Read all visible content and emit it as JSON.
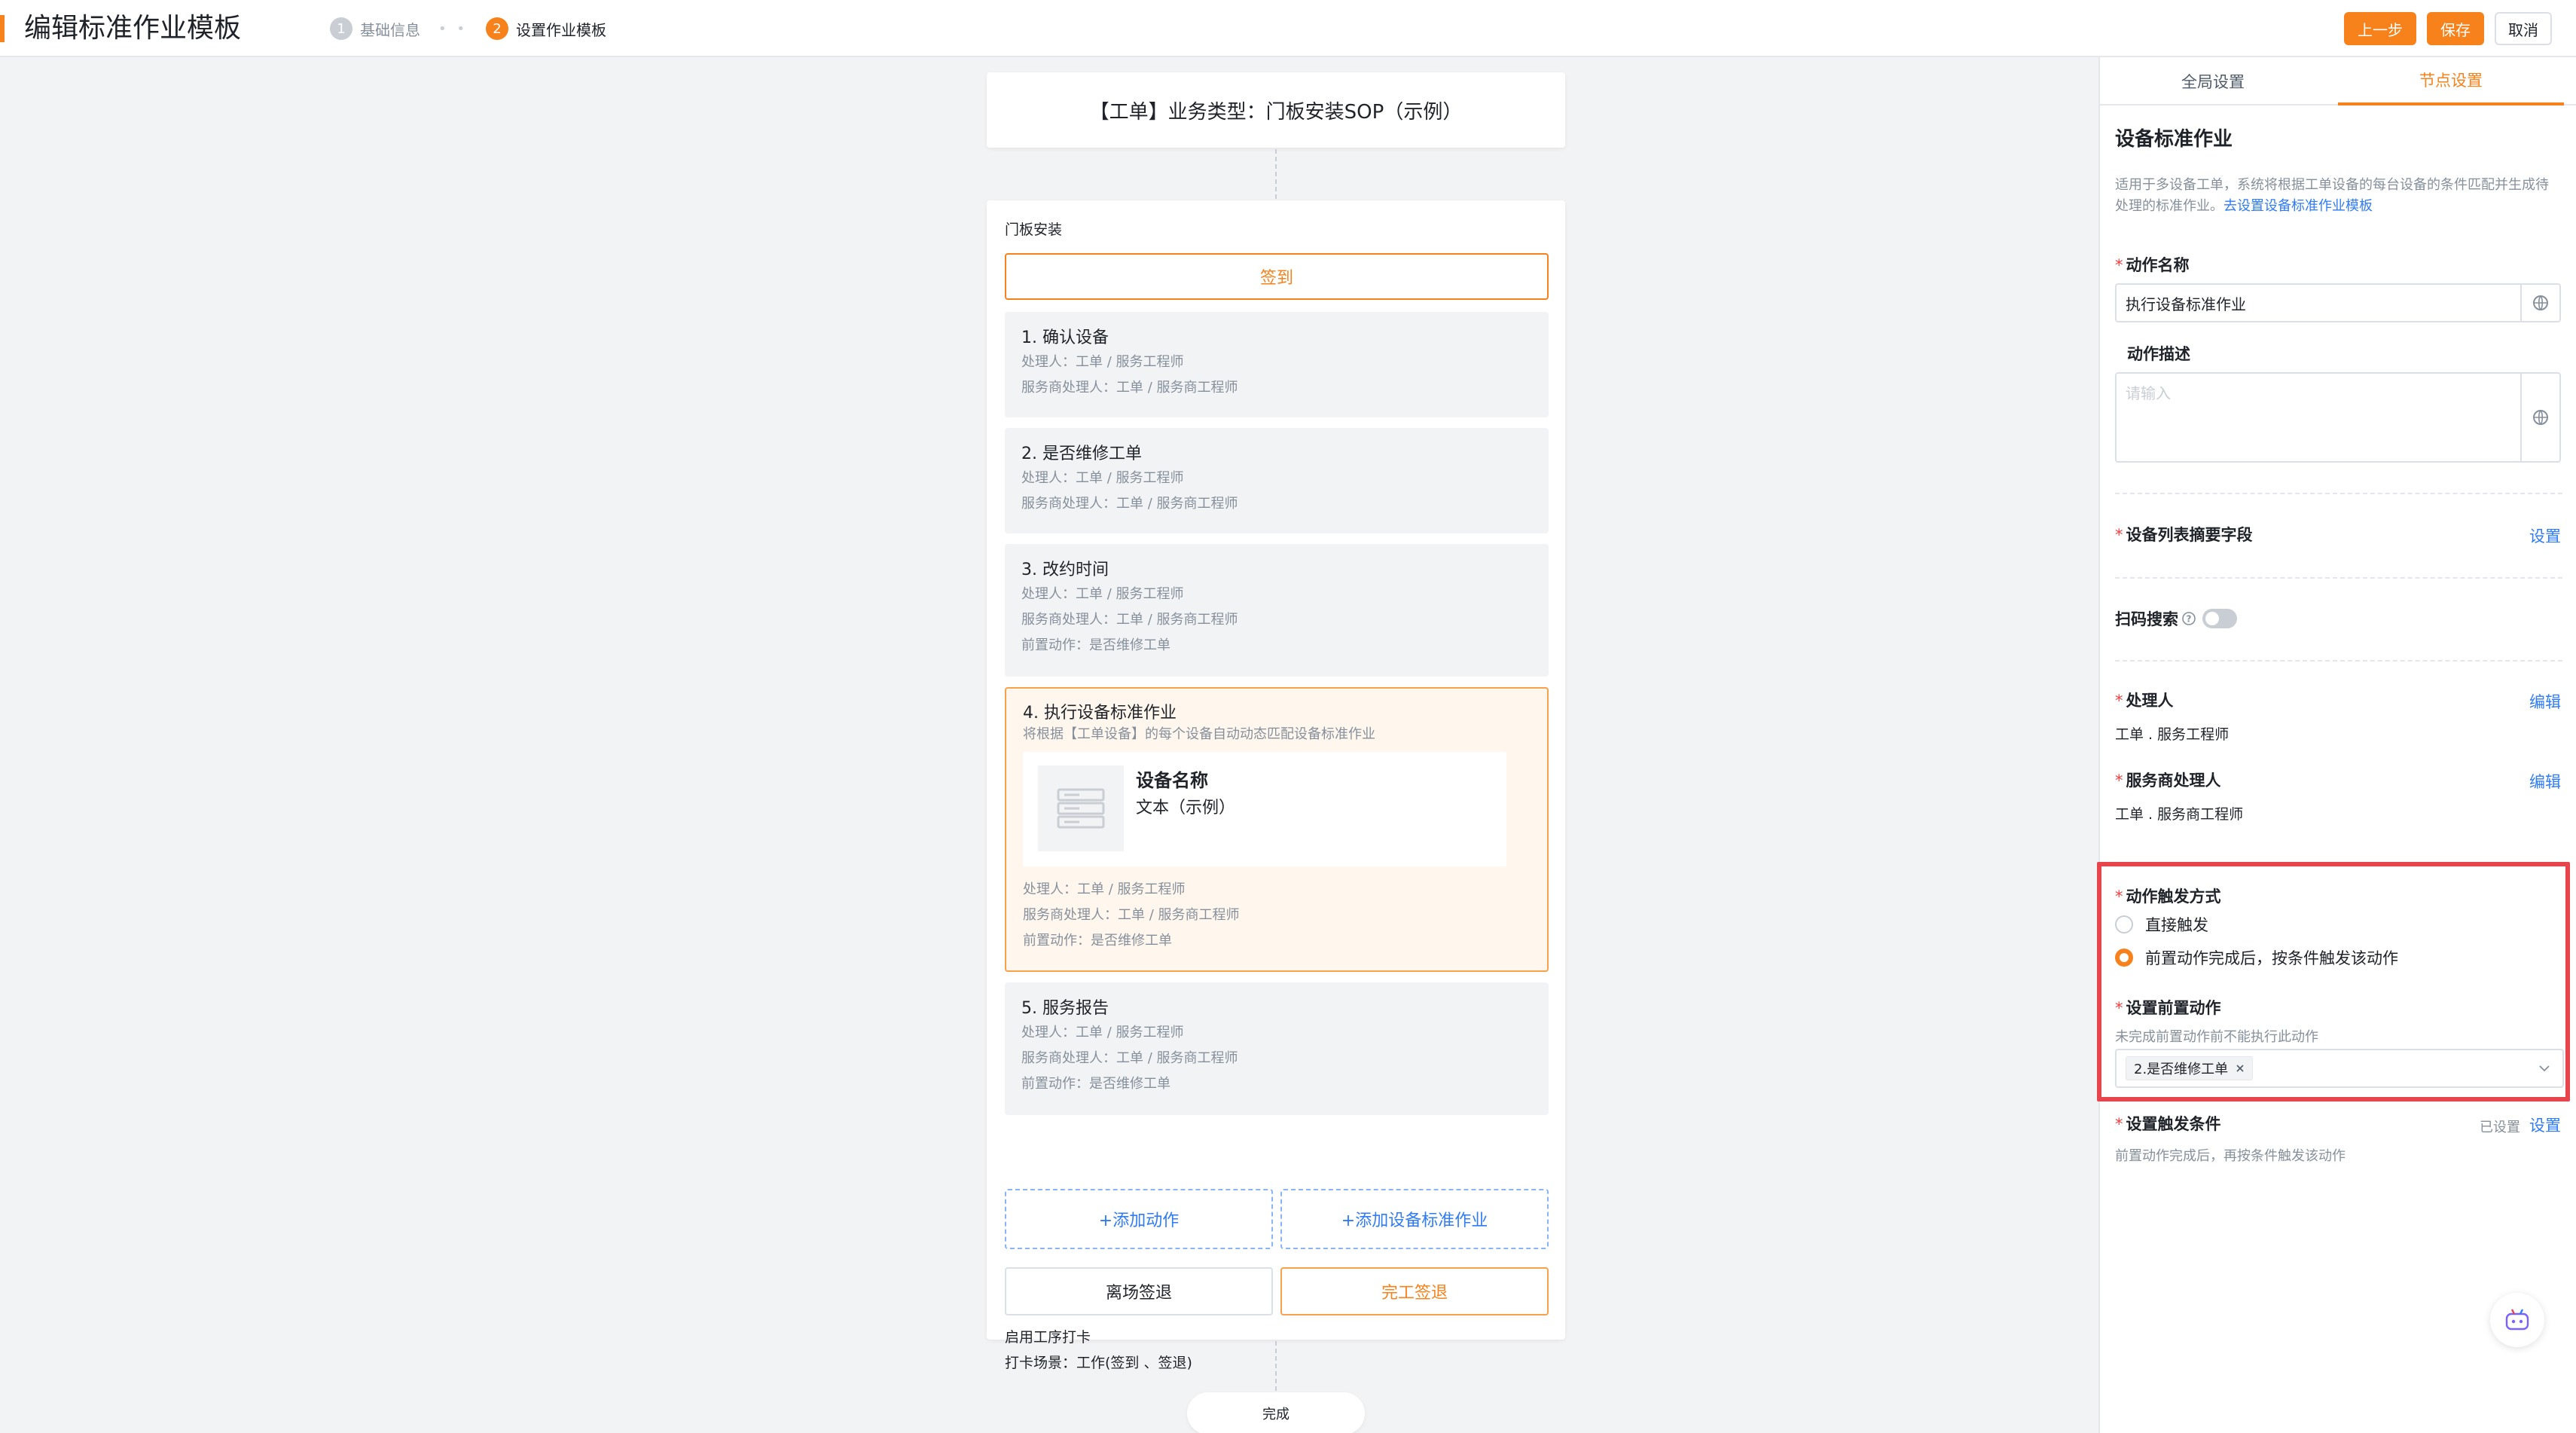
{
  "header": {
    "title": "编辑标准作业模板",
    "steps": [
      {
        "num": "1",
        "label": "基础信息",
        "state": "done"
      },
      {
        "num": "2",
        "label": "设置作业模板",
        "state": "active"
      }
    ],
    "step_separator": "• •",
    "buttons": {
      "prev": "上一步",
      "save": "保存",
      "cancel": "取消"
    }
  },
  "canvas": {
    "top_card_title": "【工单】业务类型：门板安装SOP（示例）",
    "section_title": "门板安装",
    "signin_label": "签到",
    "actions": [
      {
        "title": "1. 确认设备",
        "lines": [
          "处理人：工单 / 服务工程师",
          "服务商处理人：工单 / 服务商工程师"
        ]
      },
      {
        "title": "2. 是否维修工单",
        "lines": [
          "处理人：工单 / 服务工程师",
          "服务商处理人：工单 / 服务商工程师"
        ]
      },
      {
        "title": "3. 改约时间",
        "lines": [
          "处理人：工单 / 服务工程师",
          "服务商处理人：工单 / 服务商工程师",
          "前置动作：是否维修工单"
        ]
      },
      {
        "title": "4. 执行设备标准作业",
        "subtitle": "将根据【工单设备】的每个设备自动动态匹配设备标准作业",
        "device_name": "设备名称",
        "device_value": "文本（示例）",
        "lines": [
          "处理人：工单 / 服务工程师",
          "服务商处理人：工单 / 服务商工程师",
          "前置动作：是否维修工单"
        ]
      },
      {
        "title": "5. 服务报告",
        "lines": [
          "处理人：工单 / 服务工程师",
          "服务商处理人：工单 / 服务商工程师",
          "前置动作：是否维修工单"
        ]
      }
    ],
    "add_action": "+添加动作",
    "add_device_sop": "+添加设备标准作业",
    "leave_signout": "离场签退",
    "finish_signout": "完工签退",
    "clock_title": "启用工序打卡",
    "clock_scene": "打卡场景：工作(签到 、签退)",
    "end_node": "完成"
  },
  "panel": {
    "tabs": [
      "全局设置",
      "节点设置"
    ],
    "active_tab": 1,
    "heading": "设备标准作业",
    "description": "适用于多设备工单，系统将根据工单设备的每台设备的条件匹配并生成待处理的标准作业。",
    "description_link": "去设置设备标准作业模板",
    "action_name_label": "动作名称",
    "action_name_value": "执行设备标准作业",
    "action_desc_label": "动作描述",
    "action_desc_placeholder": "请输入",
    "summary_fields_label": "设备列表摘要字段",
    "summary_fields_link": "设置",
    "scan_search_label": "扫码搜索",
    "handler_label": "处理人",
    "handler_value": "工单 . 服务工程师",
    "handler_link": "编辑",
    "vendor_handler_label": "服务商处理人",
    "vendor_handler_value": "工单 . 服务商工程师",
    "vendor_handler_link": "编辑",
    "trigger_label": "动作触发方式",
    "trigger_options": [
      "直接触发",
      "前置动作完成后，按条件触发该动作"
    ],
    "trigger_selected": 1,
    "pre_action_label": "设置前置动作",
    "pre_action_hint": "未完成前置动作前不能执行此动作",
    "pre_action_tag": "2.是否维修工单",
    "condition_label": "设置触发条件",
    "condition_status": "已设置",
    "condition_link": "设置",
    "condition_hint": "前置动作完成后，再按条件触发该动作"
  },
  "colors": {
    "accent": "#f7821b",
    "link": "#2f7cf6",
    "highlight": "#e8444c"
  }
}
